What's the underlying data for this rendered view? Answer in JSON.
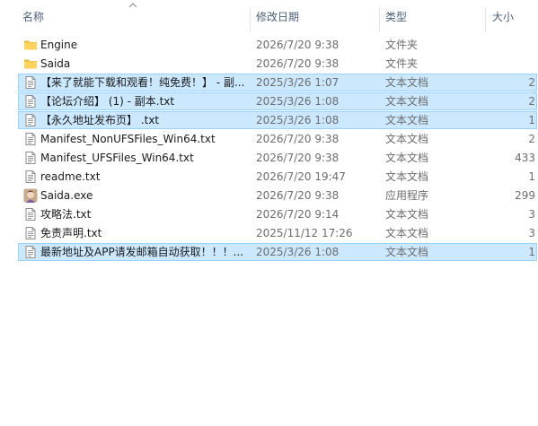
{
  "columns": {
    "name": "名称",
    "date": "修改日期",
    "type": "类型",
    "size": "大小"
  },
  "sort": {
    "column": "name",
    "direction": "ascending"
  },
  "colors": {
    "selection_bg": "#cce8ff",
    "selection_border": "#99d1ff",
    "folder": "#ffd35c",
    "header_text": "#4c607a"
  },
  "files": [
    {
      "name": "Engine",
      "date": "2026/7/20 9:38",
      "type": "文件夹",
      "size": "",
      "icon": "folder-icon",
      "selected": false
    },
    {
      "name": "Saida",
      "date": "2026/7/20 9:38",
      "type": "文件夹",
      "size": "",
      "icon": "folder-icon",
      "selected": false
    },
    {
      "name": "【来了就能下载和观看！纯免费！】 - 副...",
      "date": "2025/3/26 1:07",
      "type": "文本文档",
      "size": "2",
      "icon": "text-file-icon",
      "selected": true
    },
    {
      "name": "【论坛介绍】 (1) - 副本.txt",
      "date": "2025/3/26 1:08",
      "type": "文本文档",
      "size": "2",
      "icon": "text-file-icon",
      "selected": true
    },
    {
      "name": "【永久地址发布页】 .txt",
      "date": "2025/3/26 1:08",
      "type": "文本文档",
      "size": "1",
      "icon": "text-file-icon",
      "selected": true
    },
    {
      "name": "Manifest_NonUFSFiles_Win64.txt",
      "date": "2026/7/20 9:38",
      "type": "文本文档",
      "size": "2",
      "icon": "text-file-icon",
      "selected": false
    },
    {
      "name": "Manifest_UFSFiles_Win64.txt",
      "date": "2026/7/20 9:38",
      "type": "文本文档",
      "size": "433",
      "icon": "text-file-icon",
      "selected": false
    },
    {
      "name": "readme.txt",
      "date": "2026/7/20 19:47",
      "type": "文本文档",
      "size": "1",
      "icon": "text-file-icon",
      "selected": false
    },
    {
      "name": "Saida.exe",
      "date": "2026/7/20 9:38",
      "type": "应用程序",
      "size": "299",
      "icon": "app-avatar-icon",
      "selected": false
    },
    {
      "name": "攻略法.txt",
      "date": "2026/7/20 9:14",
      "type": "文本文档",
      "size": "3",
      "icon": "text-file-icon",
      "selected": false
    },
    {
      "name": "免责声明.txt",
      "date": "2025/11/12 17:26",
      "type": "文本文档",
      "size": "3",
      "icon": "text-file-icon",
      "selected": false
    },
    {
      "name": "最新地址及APP请发邮箱自动获取！！！...",
      "date": "2025/3/26 1:08",
      "type": "文本文档",
      "size": "1",
      "icon": "text-file-icon",
      "selected": true
    }
  ]
}
